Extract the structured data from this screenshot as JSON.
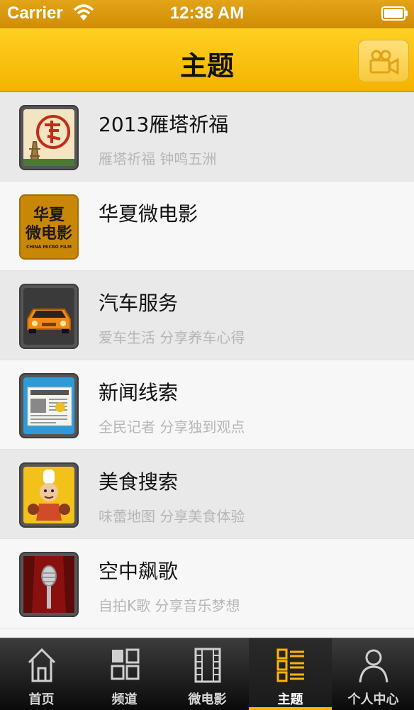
{
  "status_bar": {
    "carrier": "Carrier",
    "time": "12:38 AM"
  },
  "nav": {
    "title": "主题",
    "right_icon": "video-camera-icon"
  },
  "items": [
    {
      "title": "2013雁塔祈福",
      "subtitle": "雁塔祈福 钟鸣五洲",
      "icon": "pagoda-blessing-icon"
    },
    {
      "title": "华夏微电影",
      "subtitle": "",
      "icon": "micro-film-logo-icon",
      "logo_lines": [
        "华夏",
        "微电影",
        "CHINA MICRO FILM"
      ]
    },
    {
      "title": "汽车服务",
      "subtitle": "爱车生活 分享养车心得",
      "icon": "car-icon"
    },
    {
      "title": "新闻线索",
      "subtitle": "全民记者 分享独到观点",
      "icon": "newspaper-icon"
    },
    {
      "title": "美食搜索",
      "subtitle": "味蕾地图 分享美食体验",
      "icon": "chef-icon"
    },
    {
      "title": "空中飙歌",
      "subtitle": "自拍K歌 分享音乐梦想",
      "icon": "microphone-icon"
    }
  ],
  "tabs": [
    {
      "label": "首页",
      "icon": "home-icon"
    },
    {
      "label": "频道",
      "icon": "grid-icon"
    },
    {
      "label": "微电影",
      "icon": "film-icon"
    },
    {
      "label": "主题",
      "icon": "list-icon",
      "active": true
    },
    {
      "label": "个人中心",
      "icon": "person-icon"
    }
  ],
  "colors": {
    "accent": "#f5b300",
    "tab_active": "#ffb400"
  }
}
